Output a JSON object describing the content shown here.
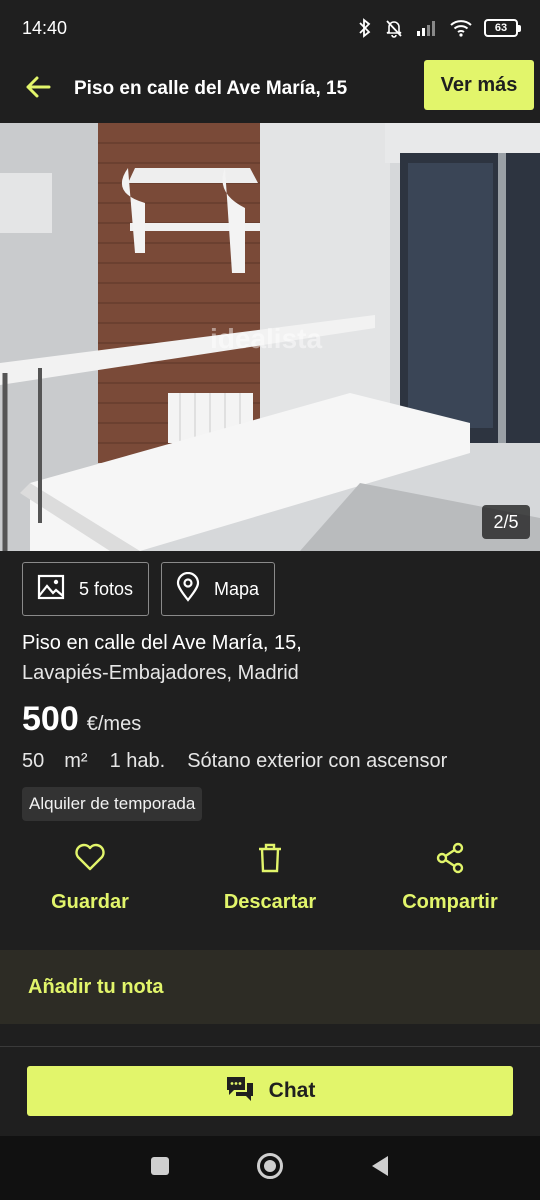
{
  "status_bar": {
    "time": "14:40",
    "battery": "63"
  },
  "header": {
    "title": "Piso en calle del Ave María, 15",
    "ver_mas_label": "Ver más",
    "back_icon": "arrow-left-icon"
  },
  "photo": {
    "counter": "2/5",
    "watermark": "idealista"
  },
  "chips": {
    "fotos_label": "5 fotos",
    "mapa_label": "Mapa"
  },
  "listing": {
    "address_line1": "Piso en calle del Ave María, 15,",
    "address_line2": "Lavapiés-Embajadores, Madrid",
    "price": "500",
    "price_unit": "€/mes",
    "area_value": "50",
    "area_unit": "m²",
    "rooms": "1 hab.",
    "floor": "Sótano exterior con ascensor",
    "tag": "Alquiler de temporada"
  },
  "actions": {
    "guardar": "Guardar",
    "descartar": "Descartar",
    "compartir": "Compartir"
  },
  "note": {
    "label": "Añadir tu nota"
  },
  "chat": {
    "label": "Chat"
  },
  "colors": {
    "accent": "#e2f56b",
    "background": "#1f1f1f",
    "note_bg": "#2d2c25"
  }
}
